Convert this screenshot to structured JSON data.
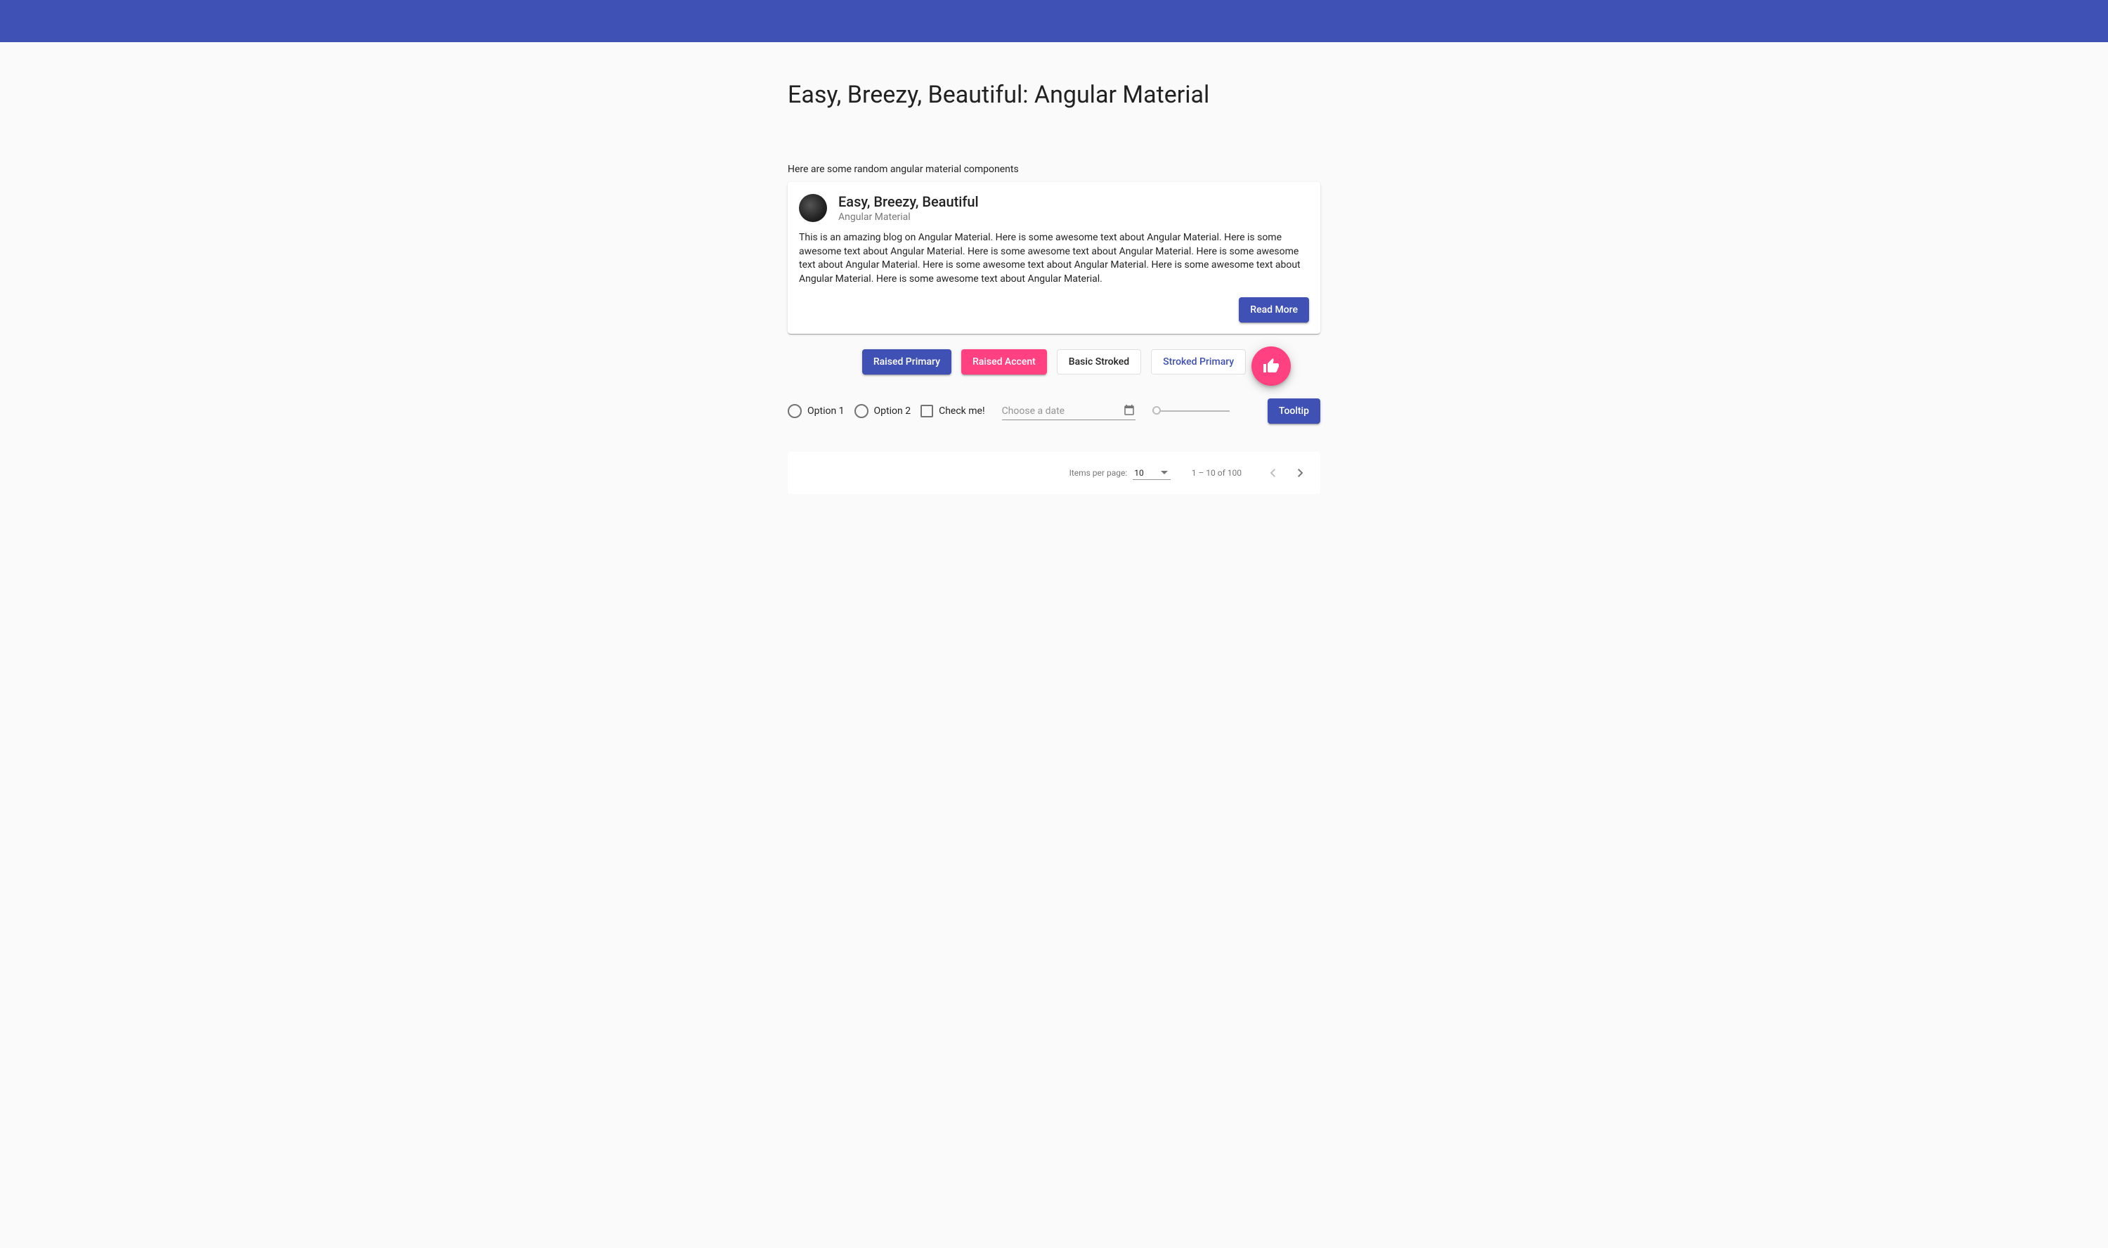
{
  "page_title": "Easy, Breezy, Beautiful: Angular Material",
  "intro_text": "Here are some random angular material components",
  "card": {
    "title": "Easy, Breezy, Beautiful",
    "subtitle": "Angular Material",
    "content": "This is an amazing blog on Angular Material. Here is some awesome text about Angular Material. Here is some awesome text about Angular Material. Here is some awesome text about Angular Material. Here is some awesome text about Angular Material. Here is some awesome text about Angular Material. Here is some awesome text about Angular Material. Here is some awesome text about Angular Material.",
    "action_label": "Read More"
  },
  "buttons": {
    "raised_primary": "Raised Primary",
    "raised_accent": "Raised Accent",
    "basic_stroked": "Basic Stroked",
    "stroked_primary": "Stroked Primary",
    "tooltip": "Tooltip"
  },
  "radios": {
    "option1": "Option 1",
    "option2": "Option 2"
  },
  "checkbox": {
    "label": "Check me!"
  },
  "datepicker": {
    "placeholder": "Choose a date"
  },
  "paginator": {
    "items_label": "Items per page:",
    "page_size": "10",
    "range_label": "1 – 10 of 100"
  }
}
